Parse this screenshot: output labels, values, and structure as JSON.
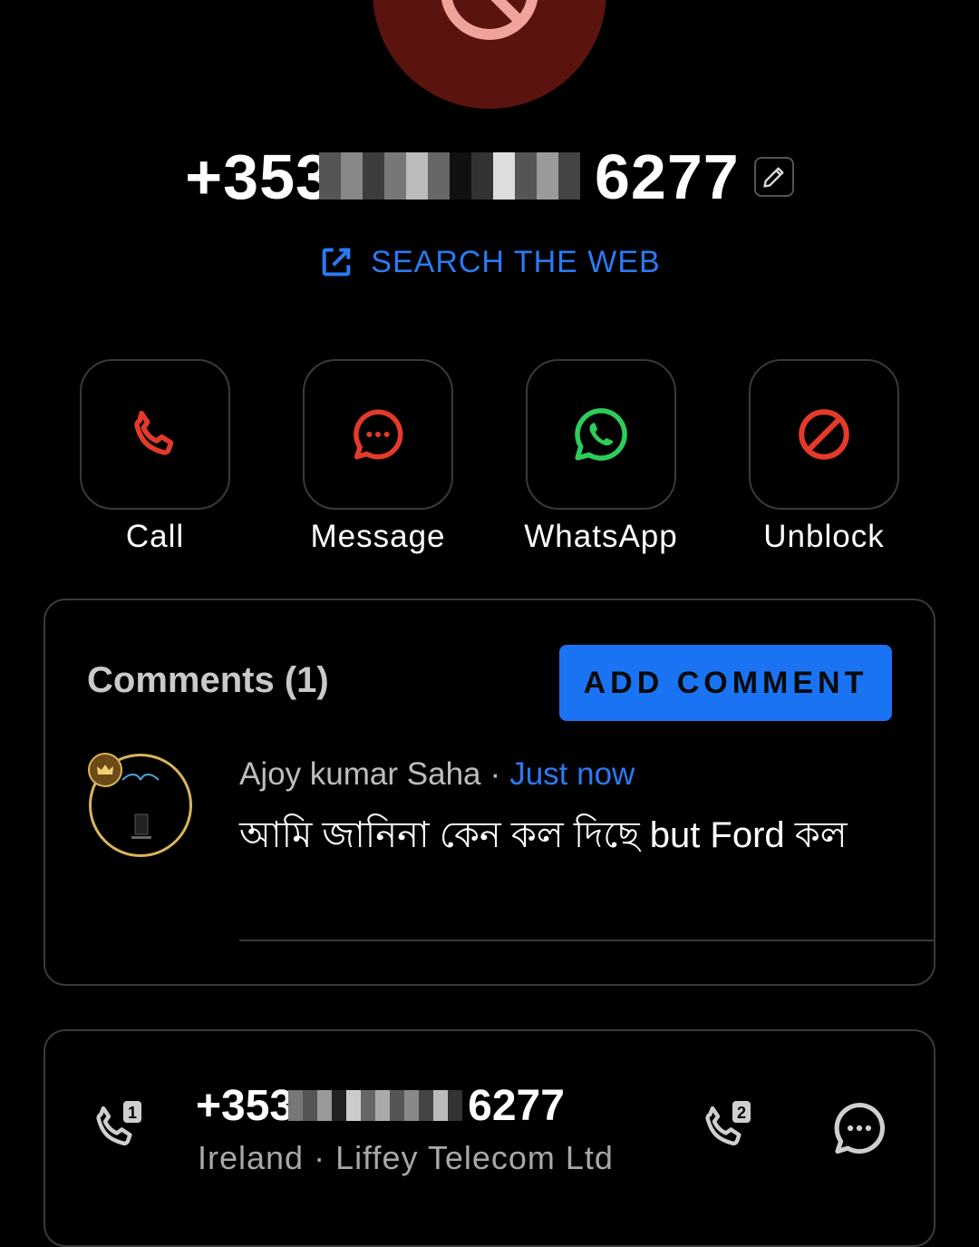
{
  "header": {
    "phone_number_prefix": "+353",
    "phone_number_suffix": "6277",
    "search_web_label": "SEARCH THE WEB"
  },
  "actions": [
    {
      "label": "Call",
      "icon": "phone-icon",
      "color": "#e53a2b"
    },
    {
      "label": "Message",
      "icon": "message-icon",
      "color": "#e53a2b"
    },
    {
      "label": "WhatsApp",
      "icon": "whatsapp-icon",
      "color": "#2ecc59"
    },
    {
      "label": "Unblock",
      "icon": "block-icon",
      "color": "#e53a2b"
    }
  ],
  "comments": {
    "title": "Comments (1)",
    "add_button": "ADD COMMENT",
    "items": [
      {
        "author": "Ajoy kumar Saha",
        "time": "Just now",
        "text": "আমি জানিনা কেন কল দিছে but  Ford কল"
      }
    ]
  },
  "number_card": {
    "number_prefix": "+353",
    "number_suffix": "6277",
    "country": "Ireland",
    "carrier": "Liffey Telecom Ltd",
    "subtitle": "Ireland · Liffey Telecom Ltd"
  },
  "colors": {
    "accent": "#1a73f2",
    "link": "#2b7af2",
    "danger": "#e53a2b",
    "whatsapp": "#2ecc59",
    "avatar_bg": "#5a130f"
  }
}
